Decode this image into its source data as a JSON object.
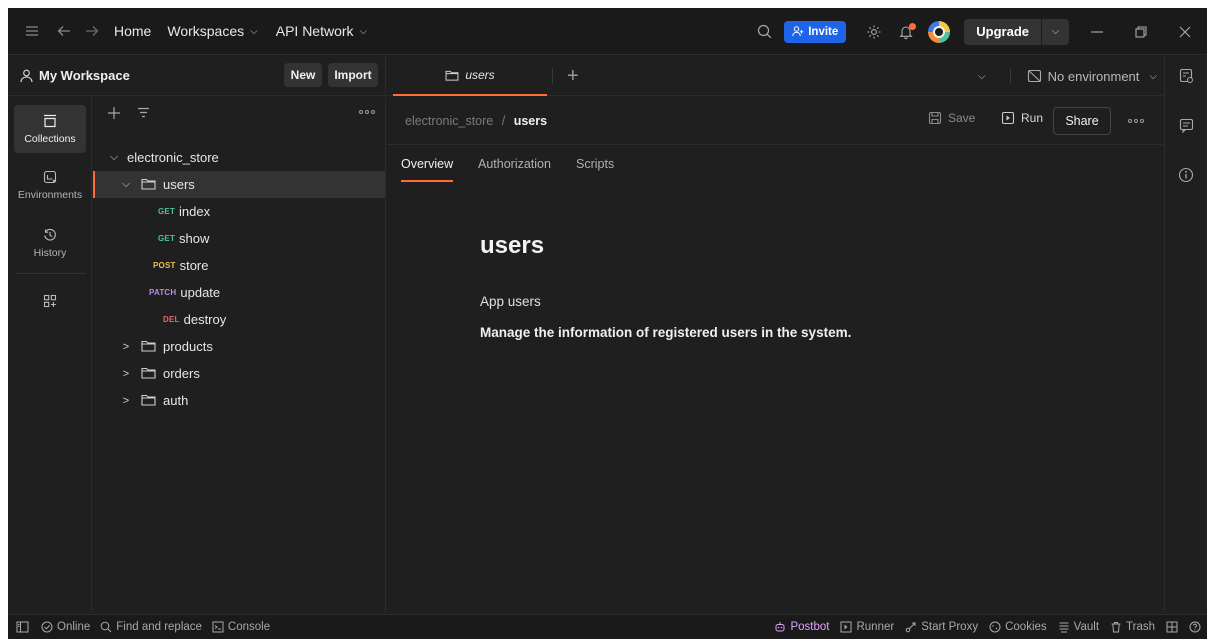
{
  "titlebar": {
    "nav": [
      "Home",
      "Workspaces",
      "API Network"
    ],
    "invite_label": "Invite",
    "upgrade_label": "Upgrade"
  },
  "workspace": {
    "title": "My Workspace",
    "new_label": "New",
    "import_label": "Import"
  },
  "rail": [
    {
      "label": "Collections",
      "icon": "collections-icon",
      "active": true
    },
    {
      "label": "Environments",
      "icon": "environments-icon",
      "active": false
    },
    {
      "label": "History",
      "icon": "history-icon",
      "active": false
    }
  ],
  "tree": {
    "collection": "electronic_store",
    "folders": [
      {
        "name": "users",
        "expanded": true
      },
      {
        "name": "products",
        "expanded": false
      },
      {
        "name": "orders",
        "expanded": false
      },
      {
        "name": "auth",
        "expanded": false
      }
    ],
    "requests": [
      {
        "method": "GET",
        "name": "index"
      },
      {
        "method": "GET",
        "name": "show"
      },
      {
        "method": "POST",
        "name": "store"
      },
      {
        "method": "PATCH",
        "name": "update"
      },
      {
        "method": "DEL",
        "name": "destroy"
      }
    ]
  },
  "tabs": {
    "open_tab": "users",
    "environment": "No environment"
  },
  "breadcrumb": {
    "parent": "electronic_store",
    "separator": "/",
    "current": "users"
  },
  "actions": {
    "save": "Save",
    "run": "Run",
    "share": "Share"
  },
  "content_tabs": [
    "Overview",
    "Authorization",
    "Scripts"
  ],
  "overview": {
    "title": "users",
    "subtitle": "App users",
    "description": "Manage the information of registered users in the system."
  },
  "statusbar": {
    "left": [
      "Online",
      "Find and replace",
      "Console"
    ],
    "right": [
      "Postbot",
      "Runner",
      "Start Proxy",
      "Cookies",
      "Vault",
      "Trash"
    ]
  },
  "colors": {
    "accent": "#ff6c37",
    "invite": "#1f63e8",
    "notification_dot": "#ff6c37"
  }
}
